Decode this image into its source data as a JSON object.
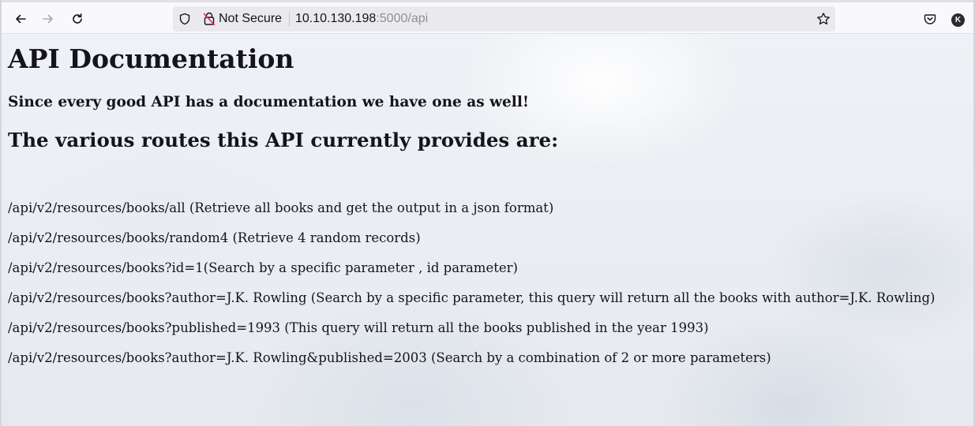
{
  "browser": {
    "security_label": "Not Secure",
    "url_host": "10.10.130.198",
    "url_rest": ":5000/api",
    "account_initial": "K",
    "icons": {
      "back": "back-arrow-icon",
      "forward": "forward-arrow-icon",
      "reload": "reload-icon",
      "shield": "shield-icon",
      "insecure": "broken-lock-icon",
      "bookmark": "star-icon",
      "pocket": "pocket-icon",
      "account": "account-avatar-icon"
    }
  },
  "page": {
    "title": "API Documentation",
    "tagline": "Since every good API has a documentation we have one as well!",
    "routes_heading": "The various routes this API currently provides are:",
    "routes": [
      "/api/v2/resources/books/all (Retrieve all books and get the output in a json format)",
      "/api/v2/resources/books/random4 (Retrieve 4 random records)",
      "/api/v2/resources/books?id=1(Search by a specific parameter , id parameter)",
      "/api/v2/resources/books?author=J.K. Rowling (Search by a specific parameter, this query will return all the books with author=J.K. Rowling)",
      "/api/v2/resources/books?published=1993 (This query will return all the books published in the year 1993)",
      "/api/v2/resources/books?author=J.K. Rowling&published=2003 (Search by a combination of 2 or more parameters)"
    ]
  }
}
